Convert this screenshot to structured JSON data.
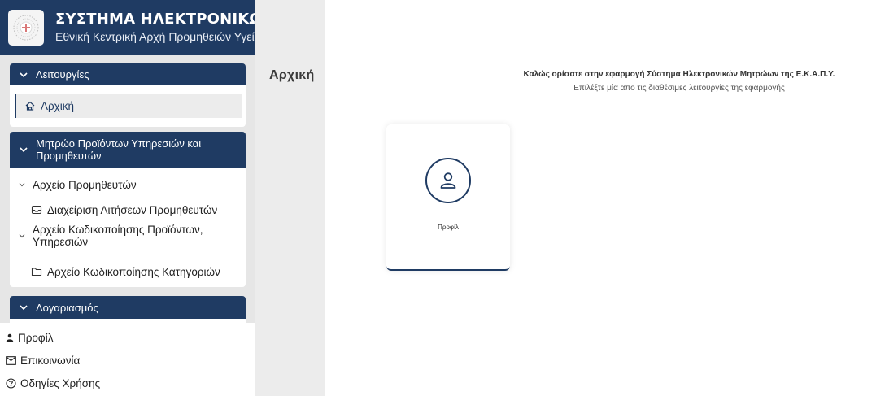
{
  "header": {
    "title": "ΣΥΣΤΗΜΑ ΗΛΕΚΤΡΟΝΙΚΩΝ ΜΗΤΡΩΩΝ",
    "subtitle": "Εθνική Κεντρική Αρχή Προμηθειών Υγείας",
    "logo_icon": "emblem-icon"
  },
  "sidebar": {
    "sections": [
      {
        "title": "Λειτουργίες",
        "items": [
          {
            "label": "Αρχική",
            "icon": "home-icon",
            "active": true
          }
        ]
      },
      {
        "title": "Μητρώο Προϊόντων Υπηρεσιών και Προμηθευτών",
        "items": [
          {
            "label": "Αρχείο Προμηθευτών",
            "icon": "chevron-down-icon"
          },
          {
            "label": "Διαχείριση Αιτήσεων Προμηθευτών",
            "icon": "inbox-icon"
          },
          {
            "label": "Αρχείο Κωδικοποίησης Προϊόντων, Υπηρεσιών",
            "icon": "chevron-down-icon"
          },
          {
            "label": "Αρχείο Κωδικοποίησης Κατηγοριών",
            "icon": "folder-icon"
          }
        ]
      },
      {
        "title": "Λογαριασμός",
        "items": [
          {
            "label": "Προφίλ",
            "icon": "user-icon"
          },
          {
            "label": "Επικοινωνία",
            "icon": "mail-icon"
          },
          {
            "label": "Οδηγίες Χρήσης",
            "icon": "help-icon"
          }
        ]
      }
    ]
  },
  "page": {
    "title": "Αρχική"
  },
  "main": {
    "welcome_title": "Καλώς ορίσατε στην εφαρμογή Σύστημα Ηλεκτρονικών Μητρώων της Ε.Κ.Α.Π.Υ.",
    "welcome_subtitle": "Επιλέξτε μία απο τις διαθέσιμες λειτουργίες της εφαρμογής",
    "cards": [
      {
        "label": "Προφίλ",
        "icon": "user-icon"
      }
    ]
  },
  "colors": {
    "brand": "#1f3b63",
    "sidebar_bg": "#e6e6e6",
    "active_item_bg": "#ececec"
  }
}
